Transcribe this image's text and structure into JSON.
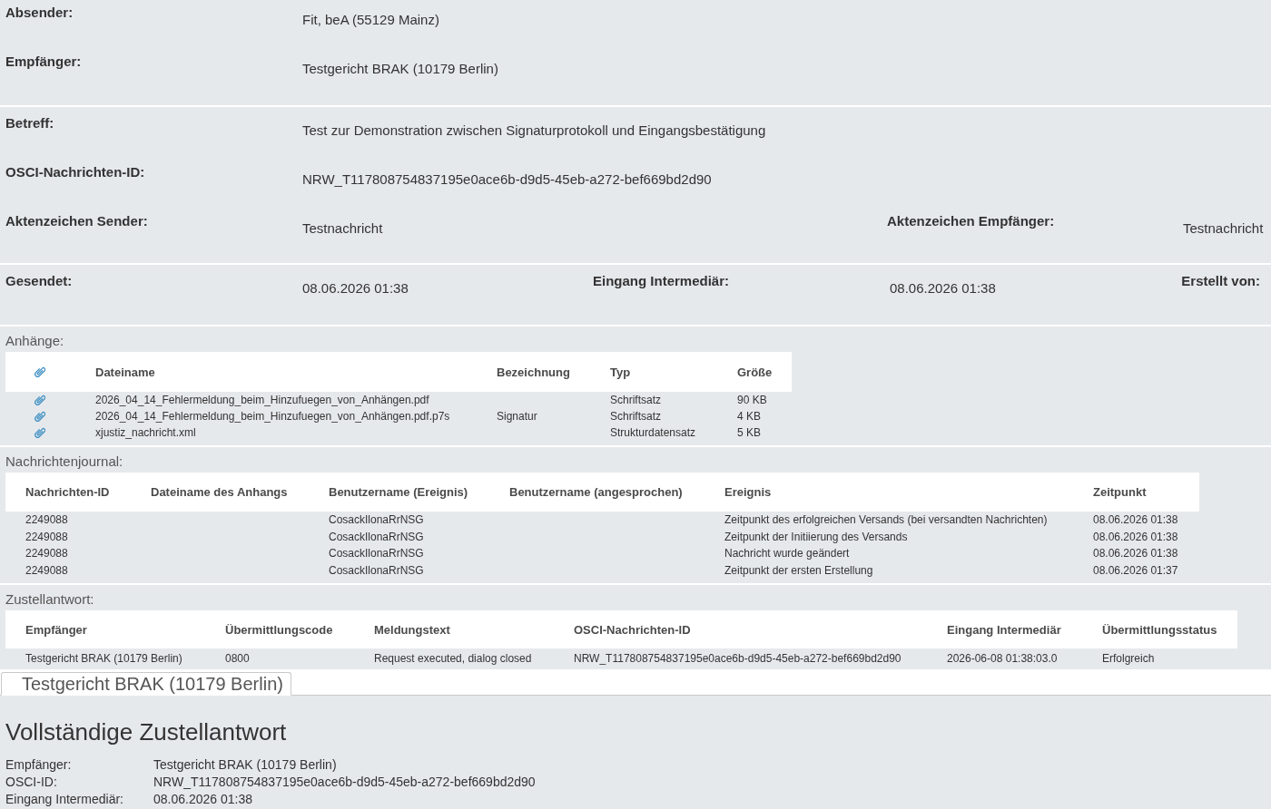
{
  "message_header": [
    {
      "rows": [
        {
          "fields": [
            {
              "label": "Absender:",
              "value": "Fit, beA (55129 Mainz)"
            }
          ]
        },
        {
          "fields": [
            {
              "label": "Empfänger:",
              "value": "Testgericht BRAK (10179 Berlin)"
            }
          ]
        }
      ]
    },
    {
      "rows": [
        {
          "fields": [
            {
              "label": "Betreff:",
              "value": "Test zur Demonstration zwischen Signaturprotokoll und Eingangsbestätigung"
            }
          ]
        },
        {
          "fields": [
            {
              "label": "OSCI-Nachrichten-ID:",
              "value": "NRW_T117808754837195e0ace6b-d9d5-45eb-a272-bef669bd2d90"
            }
          ]
        },
        {
          "fields": [
            {
              "label": "Aktenzeichen Sender:",
              "value": "Testnachricht"
            },
            {
              "label": "Aktenzeichen Empfänger:",
              "value": "Testnachricht"
            }
          ]
        }
      ]
    },
    {
      "rows": [
        {
          "fields": [
            {
              "label": "Gesendet:",
              "value": "08.06.2026 01:38"
            },
            {
              "label": "Eingang Intermediär:",
              "value": "08.06.2026 01:38"
            },
            {
              "label": "Erstellt von:"
            }
          ]
        }
      ]
    }
  ],
  "attachments": {
    "title": "Anhänge:",
    "columns": [
      "Dateiname",
      "Bezeichnung",
      "Typ",
      "Größe"
    ],
    "rows": [
      {
        "dateiname": "2026_04_14_Fehlermeldung_beim_Hinzufuegen_von_Anhängen.pdf",
        "typ": "Schriftsatz",
        "groesse": "90 KB"
      },
      {
        "dateiname": "2026_04_14_Fehlermeldung_beim_Hinzufuegen_von_Anhängen.pdf.p7s",
        "bezeichnung": "Signatur",
        "typ": "Schriftsatz",
        "groesse": "4 KB"
      },
      {
        "dateiname": "xjustiz_nachricht.xml",
        "typ": "Strukturdatensatz",
        "groesse": "5 KB"
      }
    ]
  },
  "journal": {
    "title": "Nachrichtenjournal:",
    "columns": [
      "Nachrichten-ID",
      "Dateiname des Anhangs",
      "Benutzername (Ereignis)",
      "Benutzername (angesprochen)",
      "Ereignis",
      "Zeitpunkt"
    ],
    "rows": [
      {
        "nachrichten_id": "2249088",
        "benutzername_ereignis": "CosackIlonaRrNSG",
        "ereignis": "Zeitpunkt des erfolgreichen Versands (bei versandten Nachrichten)",
        "zeitpunkt": "08.06.2026 01:38"
      },
      {
        "nachrichten_id": "2249088",
        "benutzername_ereignis": "CosackIlonaRrNSG",
        "ereignis": "Zeitpunkt der Initiierung des Versands",
        "zeitpunkt": "08.06.2026 01:38"
      },
      {
        "nachrichten_id": "2249088",
        "benutzername_ereignis": "CosackIlonaRrNSG",
        "ereignis": "Nachricht wurde geändert",
        "zeitpunkt": "08.06.2026 01:38"
      },
      {
        "nachrichten_id": "2249088",
        "benutzername_ereignis": "CosackIlonaRrNSG",
        "ereignis": "Zeitpunkt der ersten Erstellung",
        "zeitpunkt": "08.06.2026 01:37"
      }
    ]
  },
  "delivery_response": {
    "title": "Zustellantwort:",
    "columns": [
      "Empfänger",
      "Übermittlungscode",
      "Meldungstext",
      "OSCI-Nachrichten-ID",
      "Eingang Intermediär",
      "Übermittlungsstatus"
    ],
    "rows": [
      {
        "empfaenger": "Testgericht BRAK (10179 Berlin)",
        "uebermittlungscode": "0800",
        "meldungstext": "Request executed, dialog closed",
        "osci_nachrichten_id": "NRW_T117808754837195e0ace6b-d9d5-45eb-a272-bef669bd2d90",
        "eingang_intermediaer": "2026-06-08 01:38:03.0",
        "uebermittlungsstatus": "Erfolgreich"
      }
    ]
  },
  "tabs": [
    {
      "label": "Testgericht BRAK (10179 Berlin)",
      "selected": true
    }
  ],
  "full_response": {
    "heading": "Vollständige Zustellantwort",
    "fields": [
      {
        "label": "Empfänger:",
        "value": "Testgericht BRAK (10179 Berlin)"
      },
      {
        "label": "OSCI-ID:",
        "value": "NRW_T117808754837195e0ace6b-d9d5-45eb-a272-bef669bd2d90"
      },
      {
        "label": "Eingang Intermediär:",
        "value": "08.06.2026 01:38"
      }
    ]
  }
}
